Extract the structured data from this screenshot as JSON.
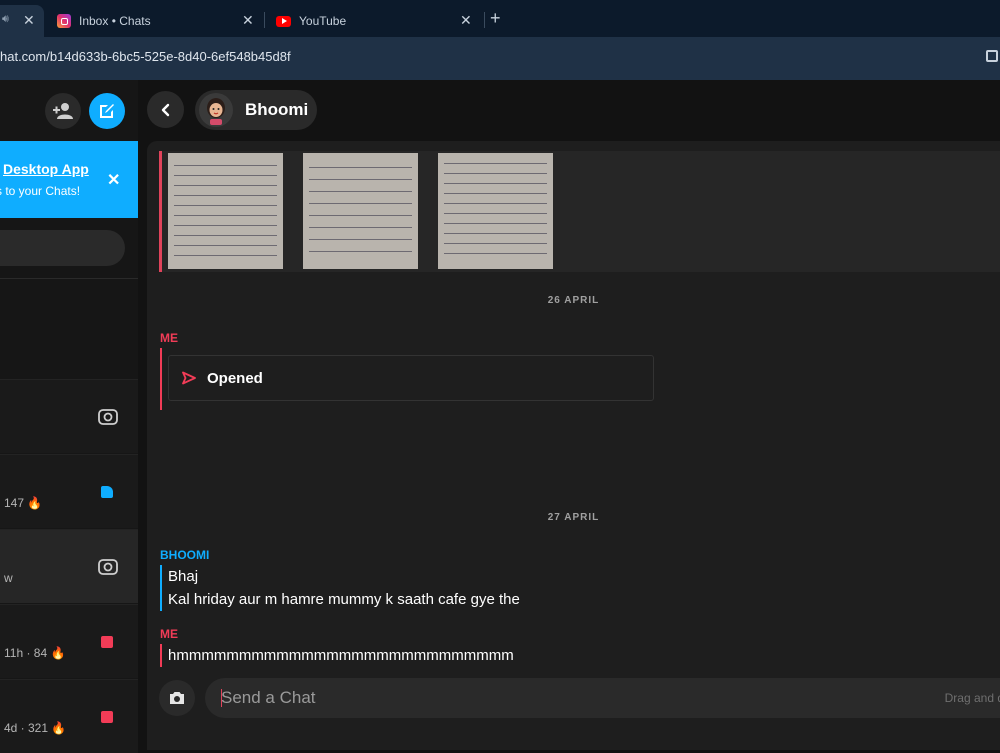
{
  "browser": {
    "tabs": [
      {
        "title": "",
        "favicon": "speaker-icon",
        "active": true
      },
      {
        "title": "Inbox • Chats",
        "favicon": "instagram-icon",
        "active": false
      },
      {
        "title": "YouTube",
        "favicon": "youtube-icon",
        "active": false
      }
    ],
    "new_tab": "+",
    "close_glyph": "✕",
    "url": "hat.com/b14d633b-6bc5-525e-8d40-6ef548b45d8f"
  },
  "sidebar": {
    "promo": {
      "title": "Desktop App",
      "subtitle": "s to your Chats!",
      "close": "✕"
    },
    "chats": [
      {
        "meta": "",
        "icon": "camera-icon"
      },
      {
        "meta": "147 🔥",
        "icon": "chat-bubble-icon",
        "color": "#0fadff"
      },
      {
        "meta": "w",
        "icon": "camera-icon"
      },
      {
        "meta": "11h · 84 🔥",
        "icon": "snap-square-icon",
        "color": "#f23c57"
      },
      {
        "meta": "4d · 321 🔥",
        "icon": "snap-square-icon",
        "color": "#f23c57"
      }
    ]
  },
  "header": {
    "friend_name": "Bhoomi"
  },
  "conversation": {
    "dates": [
      "26 APRIL",
      "27 APRIL"
    ],
    "senders": {
      "me": "ME",
      "them": "BHOOMI"
    },
    "opened_label": "Opened",
    "them_messages": [
      "Bhaj",
      "Kal hriday aur m hamre mummy k saath cafe gye the"
    ],
    "me_message": "hmmmmmmmmmmmmmmmmmmmmmmmmmmm"
  },
  "composer": {
    "placeholder": "Send a Chat",
    "hint": "Drag and d"
  },
  "colors": {
    "accent_blue": "#0fadff",
    "accent_red": "#f23c57",
    "background": "#121212",
    "panel": "#1e1e1e"
  }
}
